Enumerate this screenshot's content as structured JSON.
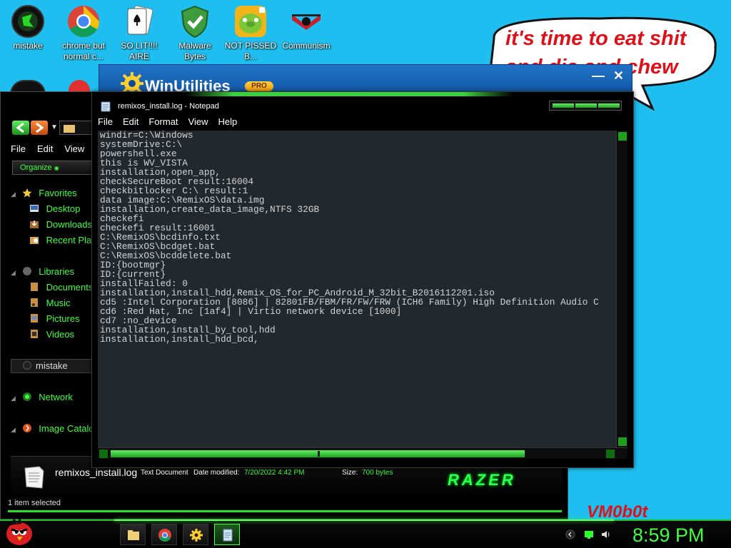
{
  "desktop": {
    "icons": [
      {
        "label": "mistake",
        "icon": "razer-ball-icon"
      },
      {
        "label": "chrome but normal c...",
        "icon": "chrome-icon"
      },
      {
        "label": "SO LIT!!!! AIRE",
        "icon": "solitaire-icon"
      },
      {
        "label": "Malware Bytes",
        "icon": "shield-check-icon"
      },
      {
        "label": "NOT PISSED B...",
        "icon": "angry-pig-icon"
      },
      {
        "label": "Communism",
        "icon": "communism-icon"
      }
    ],
    "bubble_text": "it's time to eat shit and die and chew",
    "watermark": "VM0b0t"
  },
  "winutilities": {
    "title": "WinUtilities",
    "badge": "PRO",
    "minimize": "—",
    "close": "✕"
  },
  "explorer": {
    "menu": [
      "File",
      "Edit",
      "View"
    ],
    "organize": "Organize",
    "sidebar": {
      "favorites": "Favorites",
      "desktop": "Desktop",
      "downloads": "Downloads",
      "recent": "Recent Pla",
      "libraries": "Libraries",
      "documents": "Documents",
      "music": "Music",
      "pictures": "Pictures",
      "videos": "Videos",
      "mistake": "mistake",
      "network": "Network",
      "image_catalog": "Image Catalo"
    },
    "details": {
      "filename": "remixos_install.log",
      "type": "Text Document",
      "date_label": "Date modified:",
      "date_value": "7/20/2022 4:42 PM",
      "size_label": "Size:",
      "size_value": "700 bytes",
      "brand": "RAZER"
    },
    "status": "1 item selected"
  },
  "notepad": {
    "title": "remixos_install.log - Notepad",
    "menu": [
      "File",
      "Edit",
      "Format",
      "View",
      "Help"
    ],
    "lines": [
      "windir=C:\\Windows",
      "systemDrive:C:\\",
      "powershell.exe",
      "this is WV_VISTA",
      "installation,open_app,",
      "checkSecureBoot result:16004",
      "checkbitlocker C:\\ result:1",
      "data image:C:\\RemixOS\\data.img",
      "installation,create_data_image,NTFS 32GB",
      "checkefi",
      "checkefi result:16001",
      "C:\\RemixOS\\bcdinfo.txt",
      "C:\\RemixOS\\bcdget.bat",
      "C:\\RemixOS\\bcddelete.bat",
      "ID:{bootmgr}",
      "ID:{current}",
      "installFailed: 0",
      "installation,install_hdd,Remix_OS_for_PC_Android_M_32bit_B2016112201.iso",
      "cd5 :Intel Corporation [8086] | 82801FB/FBM/FR/FW/FRW (ICH6 Family) High Definition Audio C",
      "cd6 :Red Hat, Inc [1af4] | Virtio network device [1000]",
      "cd7 :no_device",
      "installation,install_by_tool,hdd",
      "installation,install_hdd_bcd,"
    ]
  },
  "taskbar": {
    "clock": "8:59 PM",
    "items": [
      "file-explorer-icon",
      "chrome-icon",
      "gear-icon",
      "notepad-icon"
    ],
    "accent": "#3fff3f"
  }
}
